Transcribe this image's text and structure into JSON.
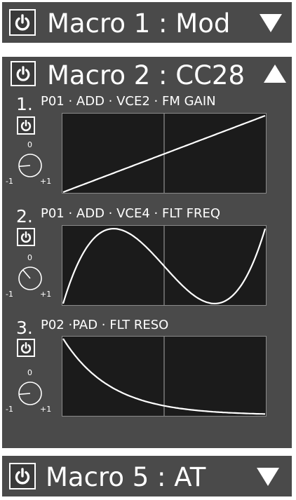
{
  "macros": [
    {
      "title": "Macro 1 : Mod",
      "expanded": false
    },
    {
      "title": "Macro 2 : CC28",
      "expanded": true,
      "slots": [
        {
          "num": "1.",
          "label": "P01 · ADD · VCE2 · FM GAIN",
          "curve": "linear",
          "knob_value": -0.7
        },
        {
          "num": "2.",
          "label": "P01 · ADD · VCE4 · FLT FREQ",
          "curve": "cubic",
          "knob_value": -0.3
        },
        {
          "num": "3.",
          "label": "P02 ·PAD · FLT RESO",
          "curve": "exp-decay",
          "knob_value": -0.7
        }
      ],
      "knob_labels": {
        "top": "0",
        "min": "-1",
        "max": "+1"
      }
    },
    {
      "title": "Macro 5 : AT",
      "expanded": false
    }
  ],
  "colors": {
    "panel": "#4a4a4a",
    "plot_bg": "#1b1b1b",
    "curve": "#ffffff",
    "text": "#ffffff"
  }
}
